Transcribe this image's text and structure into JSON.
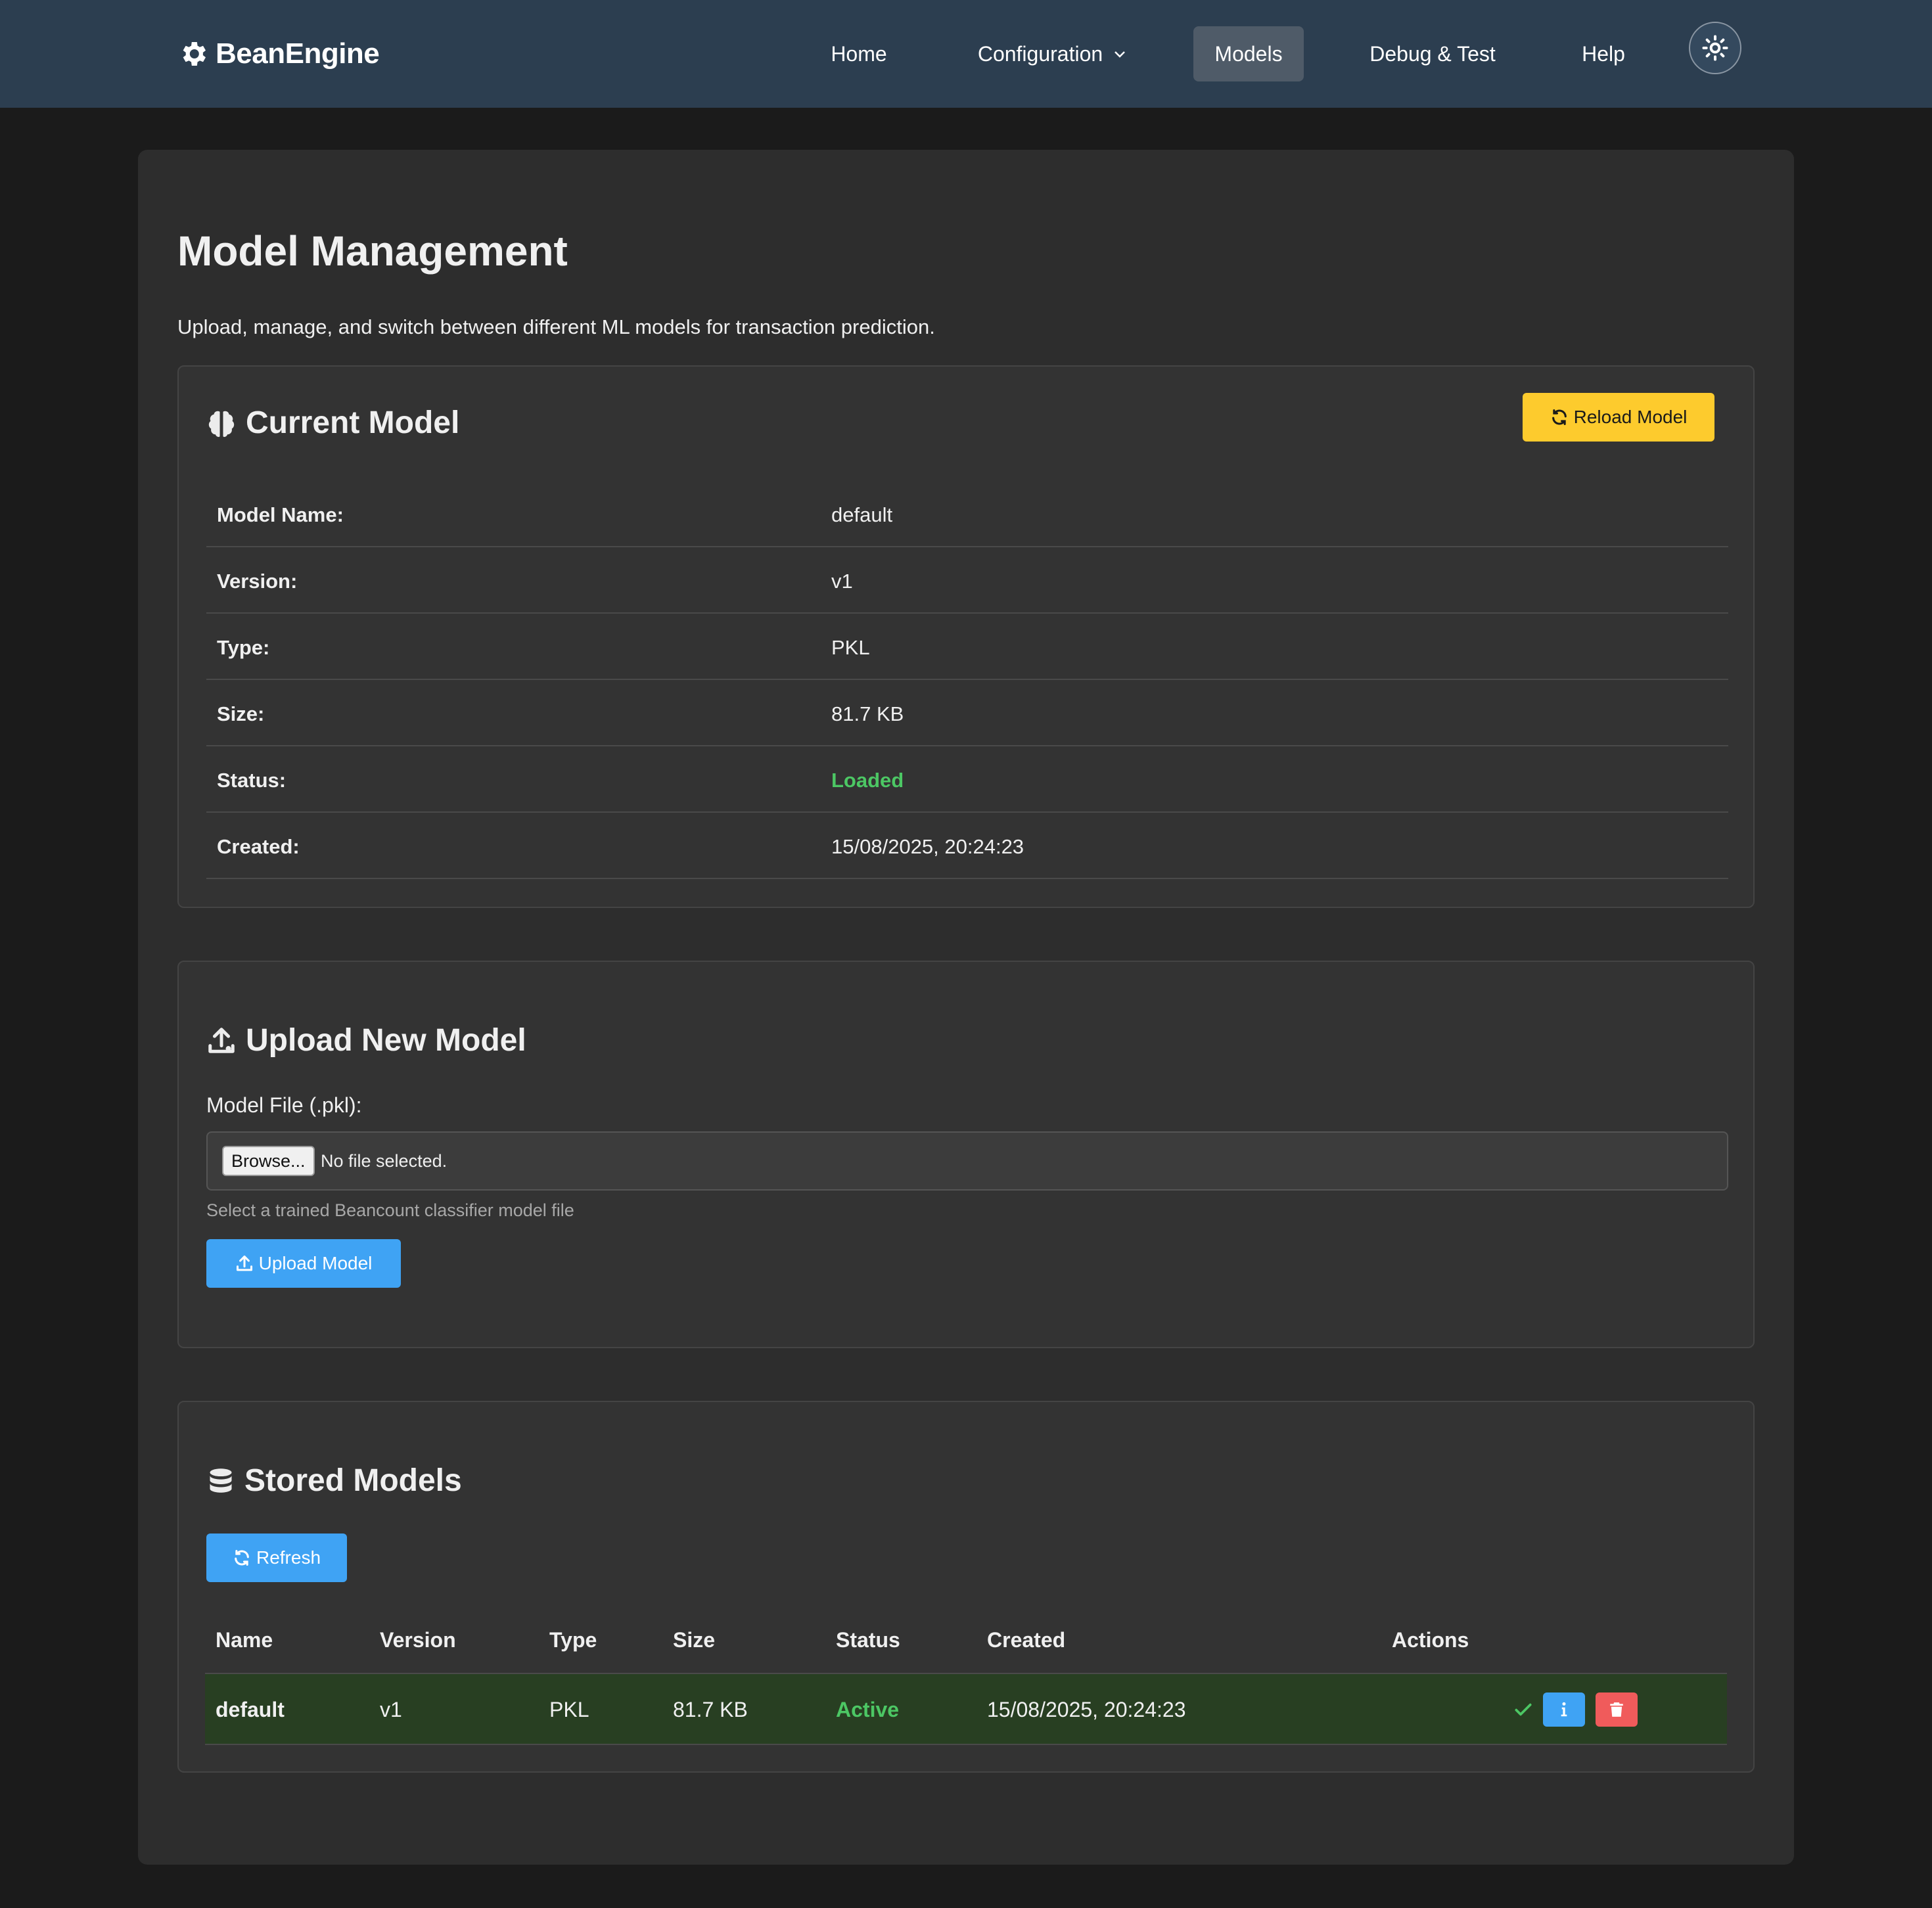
{
  "nav": {
    "brand": "BeanEngine",
    "links": [
      {
        "label": "Home"
      },
      {
        "label": "Configuration"
      },
      {
        "label": "Models"
      },
      {
        "label": "Debug & Test"
      },
      {
        "label": "Help"
      }
    ],
    "active": "Models"
  },
  "page": {
    "title": "Model Management",
    "description": "Upload, manage, and switch between different ML models for transaction prediction."
  },
  "current_model": {
    "title": "Current Model",
    "reload_label": "Reload Model",
    "rows": [
      {
        "key": "Model Name:",
        "value": "default"
      },
      {
        "key": "Version:",
        "value": "v1"
      },
      {
        "key": "Type:",
        "value": "PKL"
      },
      {
        "key": "Size:",
        "value": "81.7 KB"
      },
      {
        "key": "Status:",
        "value": "Loaded"
      },
      {
        "key": "Created:",
        "value": "15/08/2025, 20:24:23"
      }
    ]
  },
  "upload": {
    "title": "Upload New Model",
    "field_label": "Model File (.pkl):",
    "browse_label": "Browse...",
    "file_status": "No file selected.",
    "hint": "Select a trained Beancount classifier model file",
    "button_label": "Upload Model"
  },
  "stored": {
    "title": "Stored Models",
    "refresh_label": "Refresh",
    "columns": [
      "Name",
      "Version",
      "Type",
      "Size",
      "Status",
      "Created",
      "Actions"
    ],
    "rows": [
      {
        "name": "default",
        "version": "v1",
        "type": "PKL",
        "size": "81.7 KB",
        "status": "Active",
        "created": "15/08/2025, 20:24:23"
      }
    ]
  },
  "colors": {
    "navbar": "#2c3e50",
    "accent_yellow": "#fdcb2d",
    "accent_blue": "#3fa3f4",
    "success": "#4cc764",
    "danger": "#f05b5b",
    "active_row": "#283f22"
  }
}
